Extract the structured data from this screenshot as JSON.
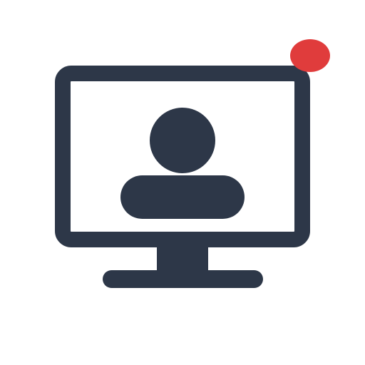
{
  "icon": {
    "name": "video-call-monitor-icon",
    "parts": {
      "monitor": "monitor-icon",
      "user": "user-avatar-icon",
      "notification": "notification-dot-icon"
    }
  },
  "colors": {
    "background": "#ffffff",
    "icon": "#2d3748",
    "notification": "#e03c3c"
  }
}
